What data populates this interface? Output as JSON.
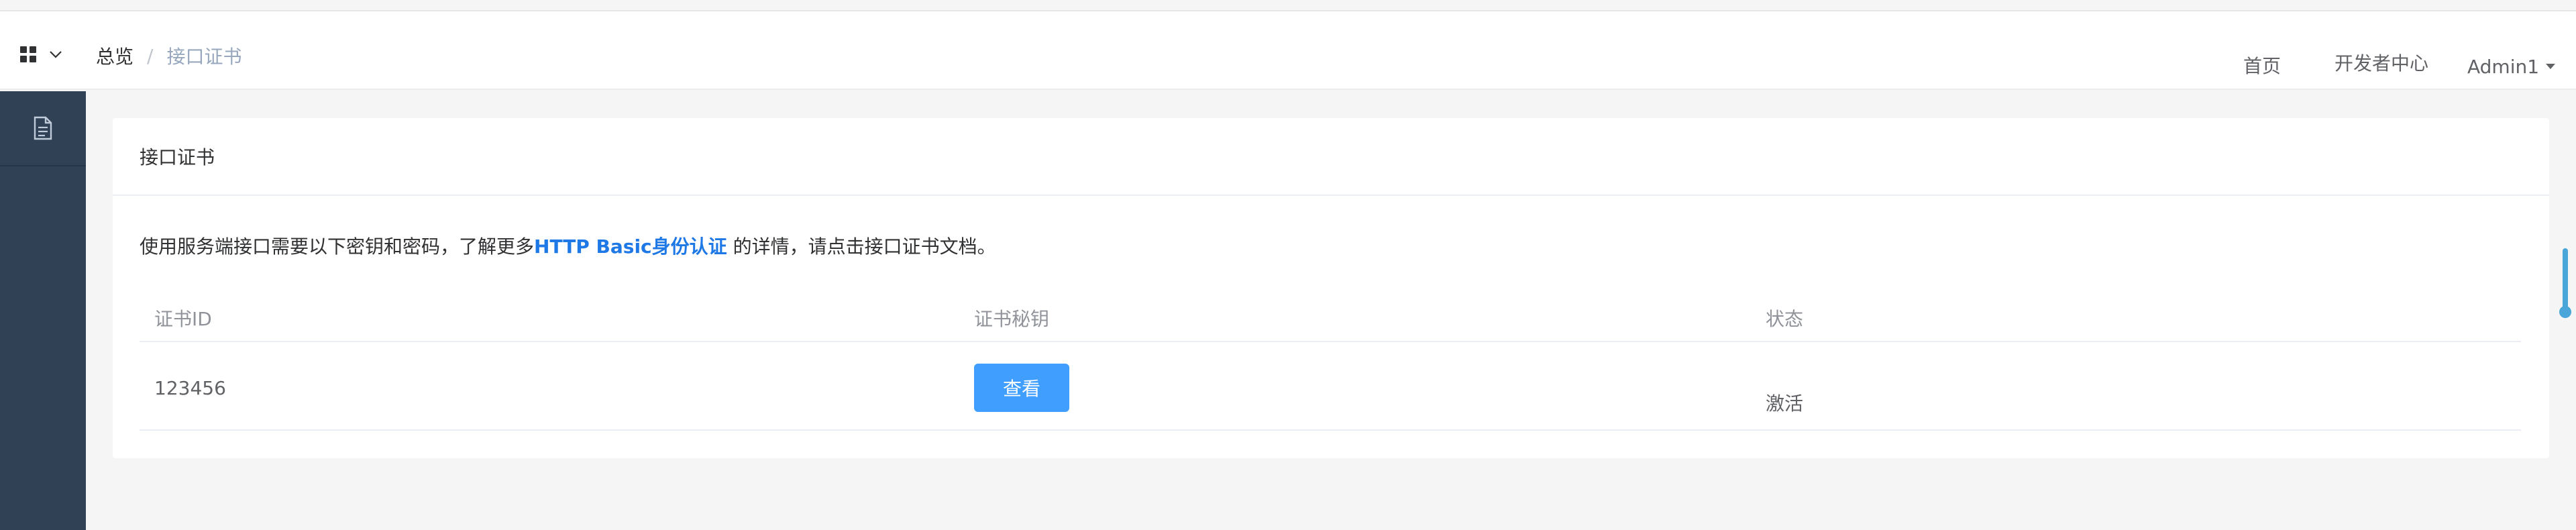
{
  "header": {
    "breadcrumb_home": "总览",
    "breadcrumb_separator": "/",
    "breadcrumb_current": "接口证书",
    "nav_home": "首页",
    "nav_developer": "开发者中心",
    "user_name": "Admin1"
  },
  "sidebar": {
    "items": [
      {
        "icon": "document-icon"
      }
    ]
  },
  "card": {
    "title": "接口证书",
    "desc_prefix": "使用服务端接口需要以下密钥和密码，了解更多",
    "desc_link": "HTTP Basic身份认证",
    "desc_suffix": " 的详情，请点击接口证书文档。"
  },
  "table": {
    "headers": [
      "证书ID",
      "证书秘钥",
      "状态"
    ],
    "rows": [
      {
        "id": "123456",
        "action_label": "查看",
        "status": "激活"
      }
    ]
  },
  "colors": {
    "sidebar_bg": "#304156",
    "primary": "#409eff",
    "link": "#1e78e6"
  }
}
